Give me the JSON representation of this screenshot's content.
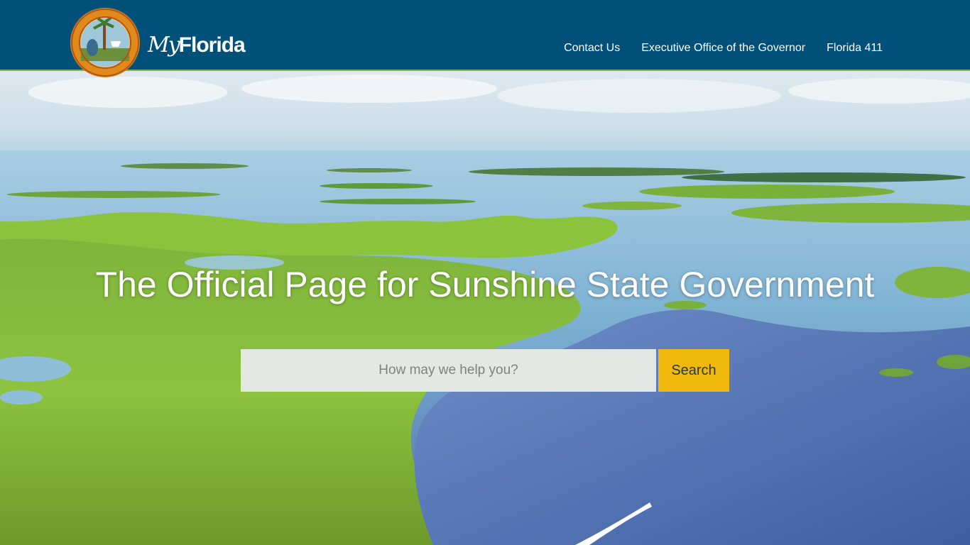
{
  "header": {
    "logo": {
      "my": "My",
      "florida": "Florida",
      "seal_text": "GREAT SEAL OF THE STATE OF FLORIDA · IN GOD WE TRUST"
    },
    "nav": [
      {
        "label": "Contact Us"
      },
      {
        "label": "Executive Office of the Governor"
      },
      {
        "label": "Florida 411"
      }
    ]
  },
  "hero": {
    "headline": "The Official Page for Sunshine State Government",
    "search": {
      "placeholder": "How may we help you?",
      "value": "",
      "button_label": "Search"
    }
  },
  "colors": {
    "header_bg": "#01507a",
    "search_button": "#f0b80d",
    "search_input_bg": "#e4e8e5"
  }
}
